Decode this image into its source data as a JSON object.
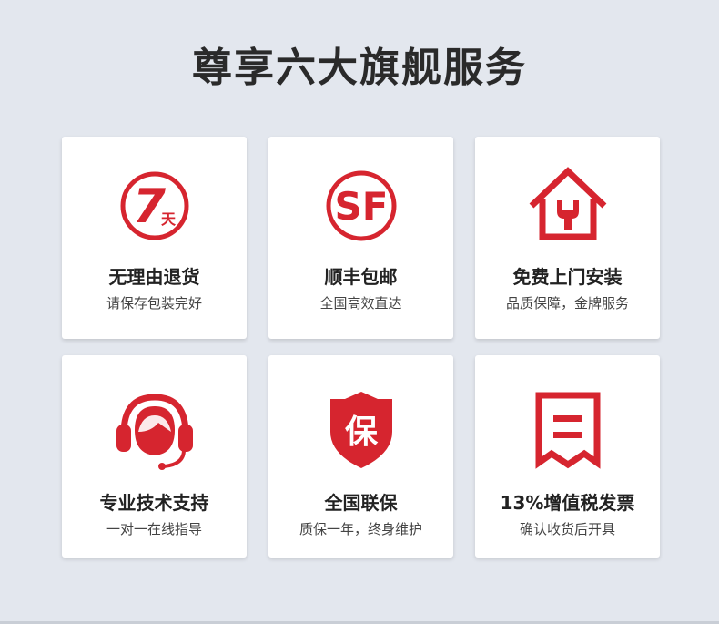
{
  "page": {
    "title": "尊享六大旗舰服务"
  },
  "colors": {
    "accent": "#d6252f",
    "background": "#e3e7ee",
    "card": "#ffffff"
  },
  "services": [
    {
      "icon": "seven-day-return-icon",
      "badge_number": "7",
      "badge_unit": "天",
      "title": "无理由退货",
      "subtitle": "请保存包装完好"
    },
    {
      "icon": "sf-express-icon",
      "badge_text": "SF",
      "title": "顺丰包邮",
      "subtitle": "全国高效直达"
    },
    {
      "icon": "home-repair-icon",
      "title": "免费上门安装",
      "subtitle": "品质保障，金牌服务"
    },
    {
      "icon": "headset-support-icon",
      "title": "专业技术支持",
      "subtitle": "一对一在线指导"
    },
    {
      "icon": "warranty-shield-icon",
      "badge_text": "保",
      "title": "全国联保",
      "subtitle": "质保一年，终身维护"
    },
    {
      "icon": "invoice-icon",
      "title": "13%增值税发票",
      "subtitle": "确认收货后开具"
    }
  ]
}
